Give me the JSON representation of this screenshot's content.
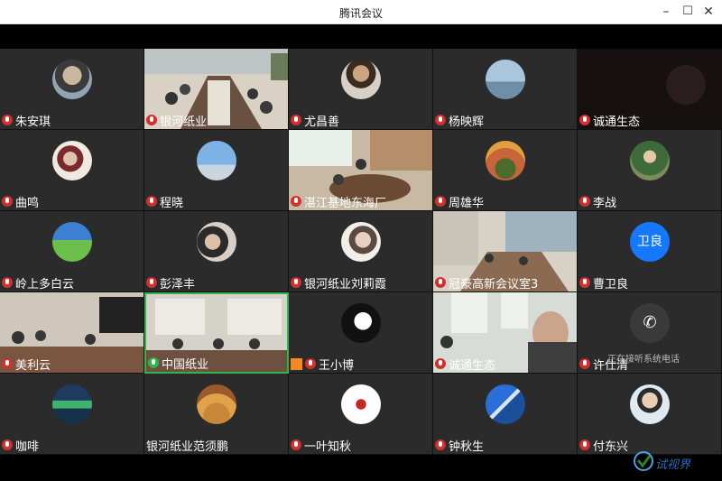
{
  "window": {
    "title": "腾讯会议",
    "controls": {
      "minimize": "–",
      "maximize": "☐",
      "close": "✕"
    }
  },
  "participants": [
    {
      "name": "朱安琪",
      "type": "avatar",
      "mic": "muted"
    },
    {
      "name": "银河纸业",
      "type": "video",
      "mic": "muted"
    },
    {
      "name": "尤昌善",
      "type": "avatar",
      "mic": "muted"
    },
    {
      "name": "杨映辉",
      "type": "avatar",
      "mic": "muted"
    },
    {
      "name": "诚通生态",
      "type": "video-dark",
      "mic": "muted"
    },
    {
      "name": "曲鸣",
      "type": "avatar",
      "mic": "muted"
    },
    {
      "name": "程晓",
      "type": "avatar",
      "mic": "muted"
    },
    {
      "name": "湛江基地东海厂",
      "type": "video",
      "mic": "muted"
    },
    {
      "name": "周雄华",
      "type": "avatar",
      "mic": "muted"
    },
    {
      "name": "李战",
      "type": "avatar",
      "mic": "muted"
    },
    {
      "name": "岭上多白云",
      "type": "avatar",
      "mic": "muted"
    },
    {
      "name": "彭泽丰",
      "type": "avatar",
      "mic": "muted"
    },
    {
      "name": "银河纸业刘莉霞",
      "type": "avatar",
      "mic": "muted"
    },
    {
      "name": "冠豪高新会议室3",
      "type": "video",
      "mic": "muted"
    },
    {
      "name": "曹卫良",
      "type": "initials",
      "initials": "卫良",
      "mic": "muted"
    },
    {
      "name": "美利云",
      "type": "video",
      "mic": "muted"
    },
    {
      "name": "中国纸业",
      "type": "video",
      "mic": "on"
    },
    {
      "name": "王小博",
      "type": "avatar",
      "mic": "muted",
      "sharing": true
    },
    {
      "name": "诚通生态",
      "type": "video",
      "mic": "muted"
    },
    {
      "name": "许仕清",
      "type": "phone",
      "mic": "muted",
      "overlay": "正在接听系统电话"
    },
    {
      "name": "咖啡",
      "type": "avatar",
      "mic": "muted"
    },
    {
      "name": "银河纸业范须鹏",
      "type": "avatar",
      "mic": "none"
    },
    {
      "name": "一叶知秋",
      "type": "avatar",
      "mic": "muted"
    },
    {
      "name": "钟秋生",
      "type": "avatar",
      "mic": "muted"
    },
    {
      "name": "付东兴",
      "type": "avatar",
      "mic": "muted"
    }
  ],
  "watermark": {
    "text": "试视界"
  },
  "colors": {
    "tile": "#2b2b2b",
    "muted_mic": "#d0312d",
    "active_mic": "#2fb34a",
    "initials_bg": "#1677ff"
  }
}
